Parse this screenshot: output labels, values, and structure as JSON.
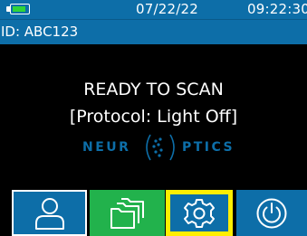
{
  "status_bar": {
    "battery_level": 0.9,
    "battery_color": "#2fd43a",
    "date": "07/22/22",
    "time": "09:22:30"
  },
  "id_bar": {
    "id_text": "ID: ABC123"
  },
  "main": {
    "status_line": "READY TO SCAN",
    "protocol_line": "[Protocol: Light Off]"
  },
  "logo": {
    "left": "NEUR",
    "right": "PTICS"
  },
  "toolbar": {
    "buttons": [
      {
        "icon": "person-icon"
      },
      {
        "icon": "folders-icon"
      },
      {
        "icon": "gear-icon",
        "highlight_color": "#ffee00"
      },
      {
        "icon": "power-icon"
      }
    ]
  },
  "colors": {
    "primary_blue": "#0d6ea8",
    "green": "#22b24c",
    "highlight": "#ffee00"
  }
}
